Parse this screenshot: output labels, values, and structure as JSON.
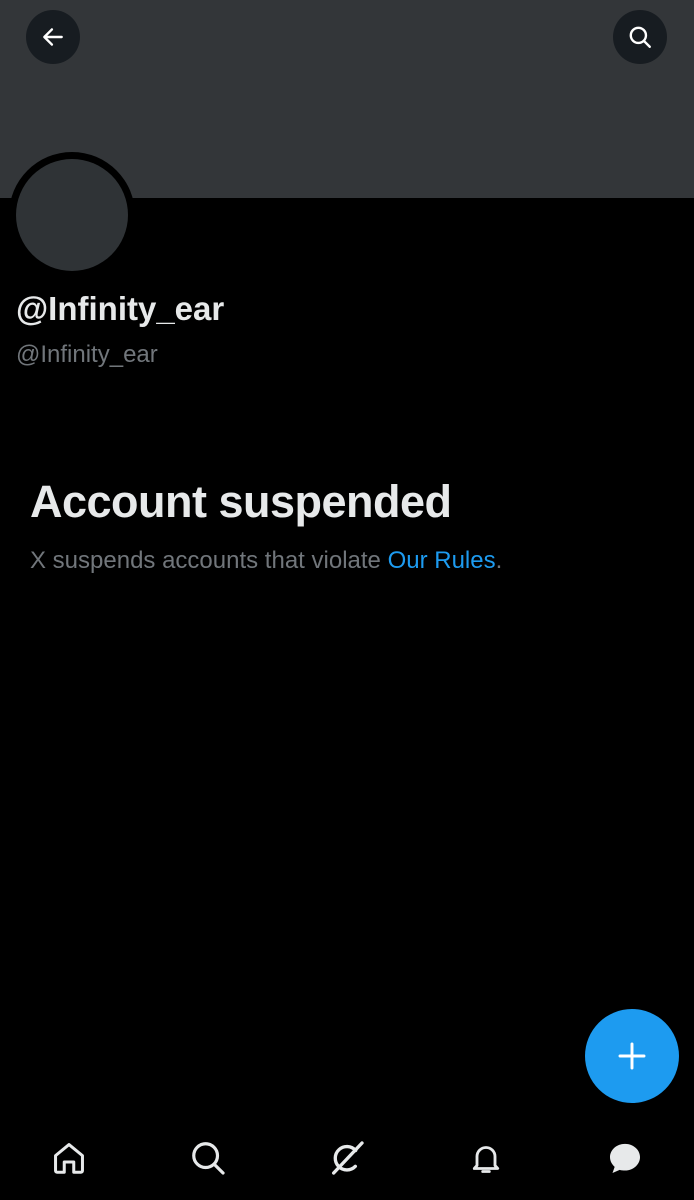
{
  "header": {
    "back_icon": "arrow-left-icon",
    "search_icon": "search-icon"
  },
  "profile": {
    "display_name": "@Infinity_ear",
    "handle": "@Infinity_ear"
  },
  "suspension": {
    "title": "Account suspended",
    "description_prefix": "X suspends accounts that violate ",
    "rules_link": "Our Rules",
    "description_suffix": "."
  },
  "fab": {
    "icon": "plus-icon"
  },
  "bottom_nav": {
    "items": [
      {
        "icon": "home-icon"
      },
      {
        "icon": "search-icon"
      },
      {
        "icon": "grok-icon"
      },
      {
        "icon": "bell-icon"
      },
      {
        "icon": "messages-icon"
      }
    ]
  },
  "colors": {
    "background": "#000000",
    "banner": "#333639",
    "avatar": "#2f3336",
    "primary_text": "#e7e9ea",
    "secondary_text": "#71767b",
    "accent": "#1d9bf0"
  }
}
